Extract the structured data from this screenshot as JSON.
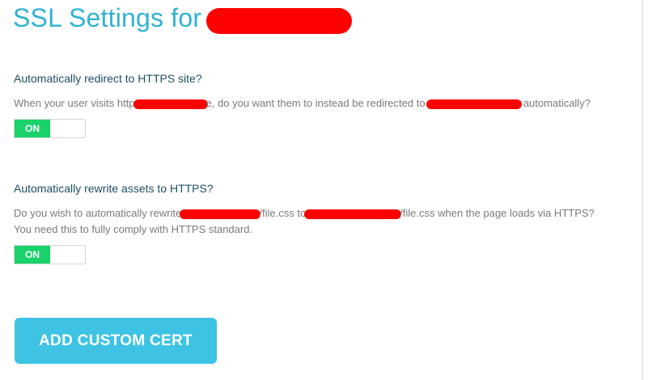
{
  "page": {
    "title": "SSL Settings for"
  },
  "redirect_section": {
    "heading": "Automatically redirect to HTTPS site?",
    "desc_part1": "When your user visits http",
    "desc_part2": "e, do you want them to instead be redirected to",
    "desc_part3": "automatically?",
    "toggle_label": "ON"
  },
  "rewrite_section": {
    "heading": "Automatically rewrite assets to HTTPS?",
    "desc_part1": "Do you wish to automatically rewrite",
    "desc_part2": "/file.css to",
    "desc_part3": "/file.css when the page loads via HTTPS?",
    "desc_line2": "You need this to fully comply with HTTPS standard.",
    "toggle_label": "ON"
  },
  "actions": {
    "add_cert_label": "ADD CUSTOM CERT"
  },
  "colors": {
    "accent": "#2fb3d4",
    "button": "#3ec3e4",
    "toggle_on": "#19d26a",
    "heading": "#1f4e63",
    "redaction": "#ff0000"
  }
}
